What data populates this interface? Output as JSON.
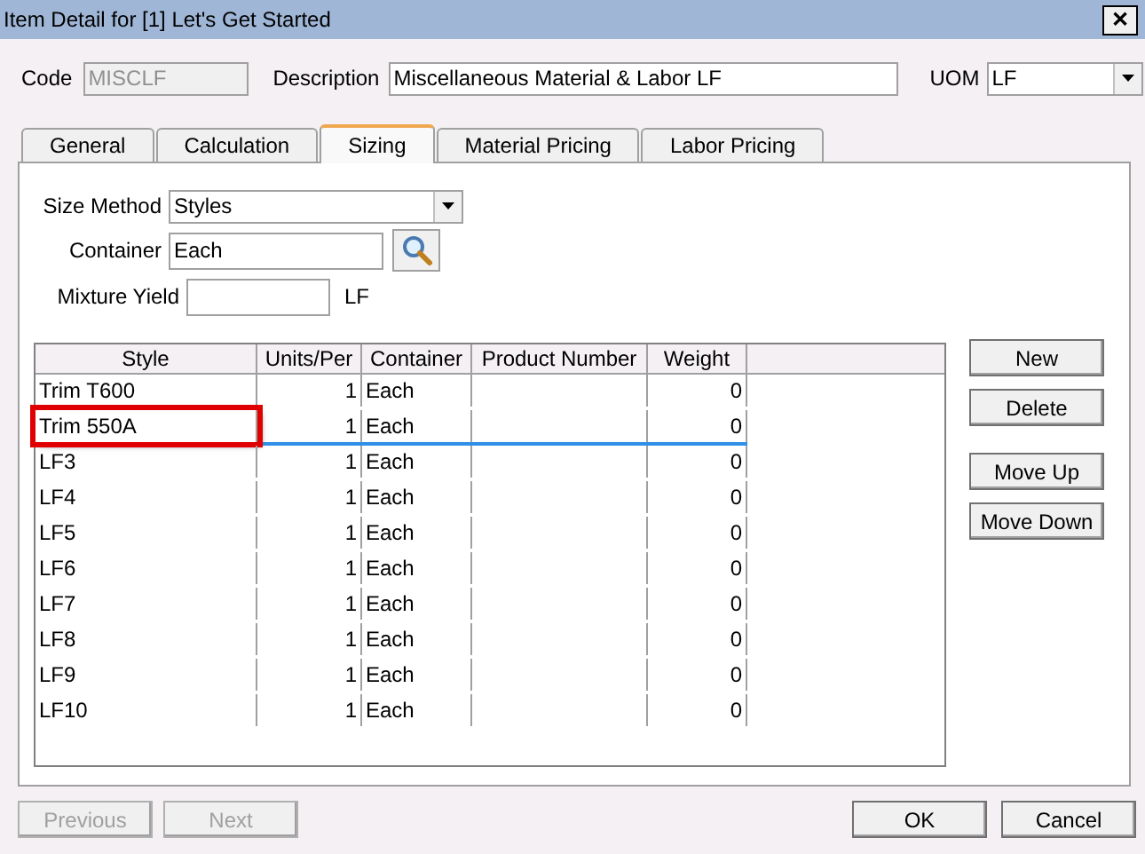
{
  "window": {
    "title": "Item Detail for [1] Let's Get Started",
    "close": "✕"
  },
  "header": {
    "code_label": "Code",
    "code": "MISCLF",
    "code_disabled": true,
    "description_label": "Description",
    "description": "Miscellaneous Material & Labor LF",
    "uom_label": "UOM",
    "uom": "LF"
  },
  "tabs": [
    {
      "label": "General",
      "selected": false
    },
    {
      "label": "Calculation",
      "selected": false
    },
    {
      "label": "Sizing",
      "selected": true
    },
    {
      "label": "Material Pricing",
      "selected": false
    },
    {
      "label": "Labor Pricing",
      "selected": false
    }
  ],
  "sizing": {
    "size_method_label": "Size Method",
    "size_method": "Styles",
    "container_label": "Container",
    "container": "Each",
    "mixture_yield_label": "Mixture Yield",
    "mixture_yield_unit": "LF"
  },
  "table": {
    "columns": [
      "Style",
      "Units/Per",
      "Container",
      "Product Number",
      "Weight"
    ],
    "rows": [
      {
        "cells": [
          "Trim T600",
          "1",
          "Each",
          "",
          "0"
        ],
        "selected": false,
        "highlighted": false
      },
      {
        "cells": [
          "Trim 550A",
          "1",
          "Each",
          "",
          "0"
        ],
        "selected": true,
        "highlighted": true
      },
      {
        "cells": [
          "LF3",
          "1",
          "Each",
          "",
          "0"
        ],
        "selected": false,
        "highlighted": false
      },
      {
        "cells": [
          "LF4",
          "1",
          "Each",
          "",
          "0"
        ],
        "selected": false,
        "highlighted": false
      },
      {
        "cells": [
          "LF5",
          "1",
          "Each",
          "",
          "0"
        ],
        "selected": false,
        "highlighted": false
      },
      {
        "cells": [
          "LF6",
          "1",
          "Each",
          "",
          "0"
        ],
        "selected": false,
        "highlighted": false
      },
      {
        "cells": [
          "LF7",
          "1",
          "Each",
          "",
          "0"
        ],
        "selected": false,
        "highlighted": false
      },
      {
        "cells": [
          "LF8",
          "1",
          "Each",
          "",
          "0"
        ],
        "selected": false,
        "highlighted": false
      },
      {
        "cells": [
          "LF9",
          "1",
          "Each",
          "",
          "0"
        ],
        "selected": false,
        "highlighted": false
      },
      {
        "cells": [
          "LF10",
          "1",
          "Each",
          "",
          "0"
        ],
        "selected": false,
        "highlighted": false
      }
    ]
  },
  "side_buttons": [
    "New",
    "Delete",
    "Move Up",
    "Move Down"
  ],
  "footer": [
    {
      "label": "Previous",
      "disabled": true
    },
    {
      "label": "Next",
      "disabled": true
    },
    {
      "label": "OK",
      "disabled": false
    },
    {
      "label": "Cancel",
      "disabled": false
    }
  ]
}
